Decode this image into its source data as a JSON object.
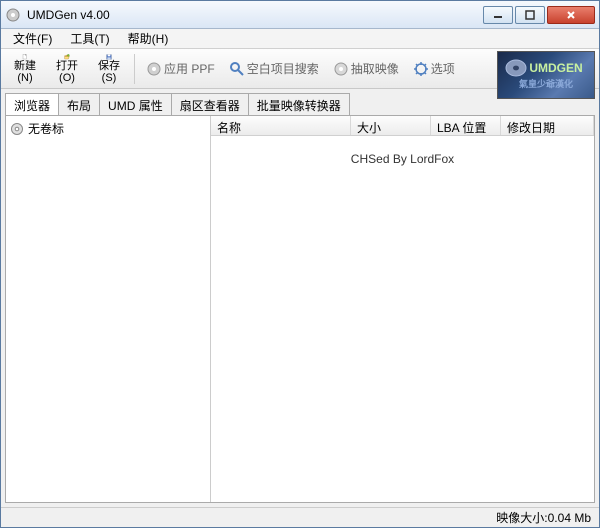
{
  "window": {
    "title": "UMDGen v4.00"
  },
  "menu": {
    "file": "文件(F)",
    "tools": "工具(T)",
    "help": "帮助(H)"
  },
  "toolbar": {
    "new": "新建\n(N)",
    "open": "打开\n(O)",
    "save": "保存\n(S)",
    "apply_ppf": "应用 PPF",
    "search_empty": "空白项目搜索",
    "extract": "抽取映像",
    "options": "选项"
  },
  "logo": {
    "main": "UMDGEN",
    "sub": "氣皇少爺漢化"
  },
  "tabs": {
    "browser": "浏览器",
    "layout": "布局",
    "umd_attrs": "UMD 属性",
    "sector_viewer": "扇区查看器",
    "batch_converter": "批量映像转换器"
  },
  "tree": {
    "root": "无卷标"
  },
  "columns": {
    "name": "名称",
    "size": "大小",
    "lba": "LBA 位置",
    "modified": "修改日期"
  },
  "credit": "CHSed By LordFox",
  "status": {
    "image_size": "映像大小:0.04 Mb"
  }
}
